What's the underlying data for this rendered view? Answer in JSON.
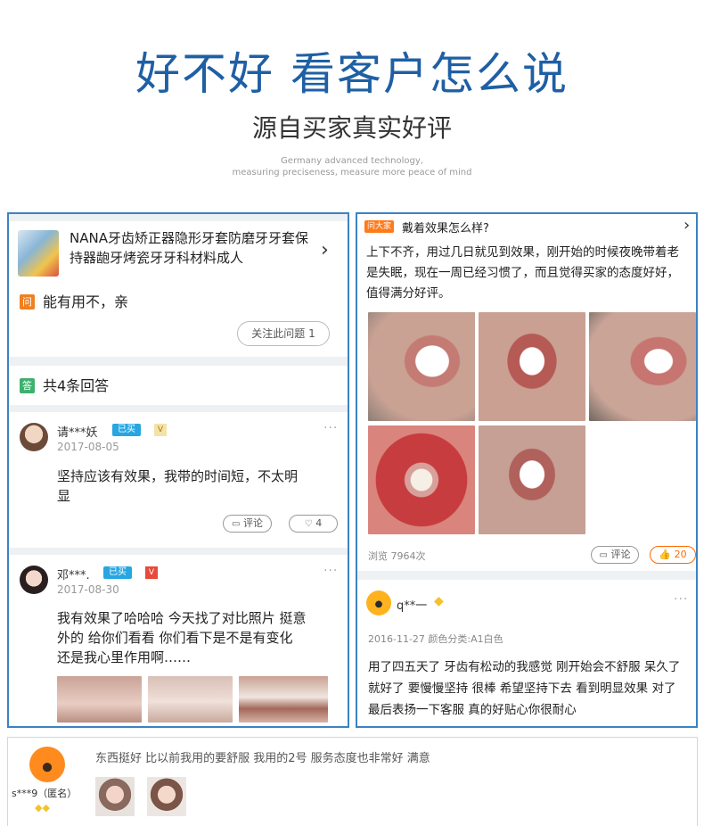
{
  "hero": {
    "title": "好不好 看客户怎么说",
    "subtitle": "源自买家真实好评",
    "en_line1": "Germany advanced technology,",
    "en_line2": "measuring preciseness, measure more peace of mind"
  },
  "left_panel": {
    "product": {
      "title": "NANA牙齿矫正器隐形牙套防磨牙牙套保持器龅牙烤瓷牙牙科材料成人",
      "chevron_icon": "chevron-right-icon"
    },
    "question": {
      "badge": "问",
      "text": "能有用不，亲",
      "follow_label": "关注此问题 1"
    },
    "answers_header": {
      "badge": "答",
      "text": "共4条回答"
    },
    "answers": [
      {
        "user": "请***妖",
        "bought_tag": "已买",
        "level_tag": "V",
        "date": "2017-08-05",
        "text_line1": "坚持应该有效果，我带的时间短，不太明",
        "text_line2": "显",
        "comment_label": "评论",
        "like_count": "4"
      },
      {
        "user": "邓***.",
        "bought_tag": "已买",
        "level_tag": "V",
        "date": "2017-08-30",
        "text_line1": "我有效果了哈哈哈 今天找了对比照片 挺意",
        "text_line2": "外的 给你们看看 你们看下是不是有变化",
        "text_line3": "还是我心里作用啊……"
      }
    ],
    "more_icon": "more-dots-icon"
  },
  "right_panel": {
    "ask_tag": "问大家",
    "question": "戴着效果怎么样?",
    "answer_line1": "上下不齐，用过几日就见到效果，刚开始的时候夜晚带着老",
    "answer_line2": "是失眠，现在一周已经习惯了，而且觉得买家的态度好好，",
    "answer_line3": "值得满分好评。",
    "views": "浏览 7964次",
    "comment_label": "评论",
    "like_count": "20",
    "review": {
      "user": "q**一",
      "meta": "2016-11-27 颜色分类:A1白色",
      "line1": "用了四五天了 牙齿有松动的我感觉 刚开始会不舒服 呆久了",
      "line2": "就好了 要慢慢坚持 很棒 希望坚持下去 看到明显效果 对了",
      "line3": "最后表扬一下客服 真的好贴心你很耐心"
    }
  },
  "bottom_review": {
    "user": "s***9（匿名）",
    "text": "东西挺好 比以前我用的要舒服 我用的2号 服务态度也非常好 满意"
  },
  "colors": {
    "brand_blue": "#1f5fa4",
    "panel_border": "#3d82c2",
    "tag_blue": "#27a6e1",
    "question_orange": "#f08020",
    "answer_green": "#3eb06d",
    "like_orange": "#ff6a00"
  }
}
